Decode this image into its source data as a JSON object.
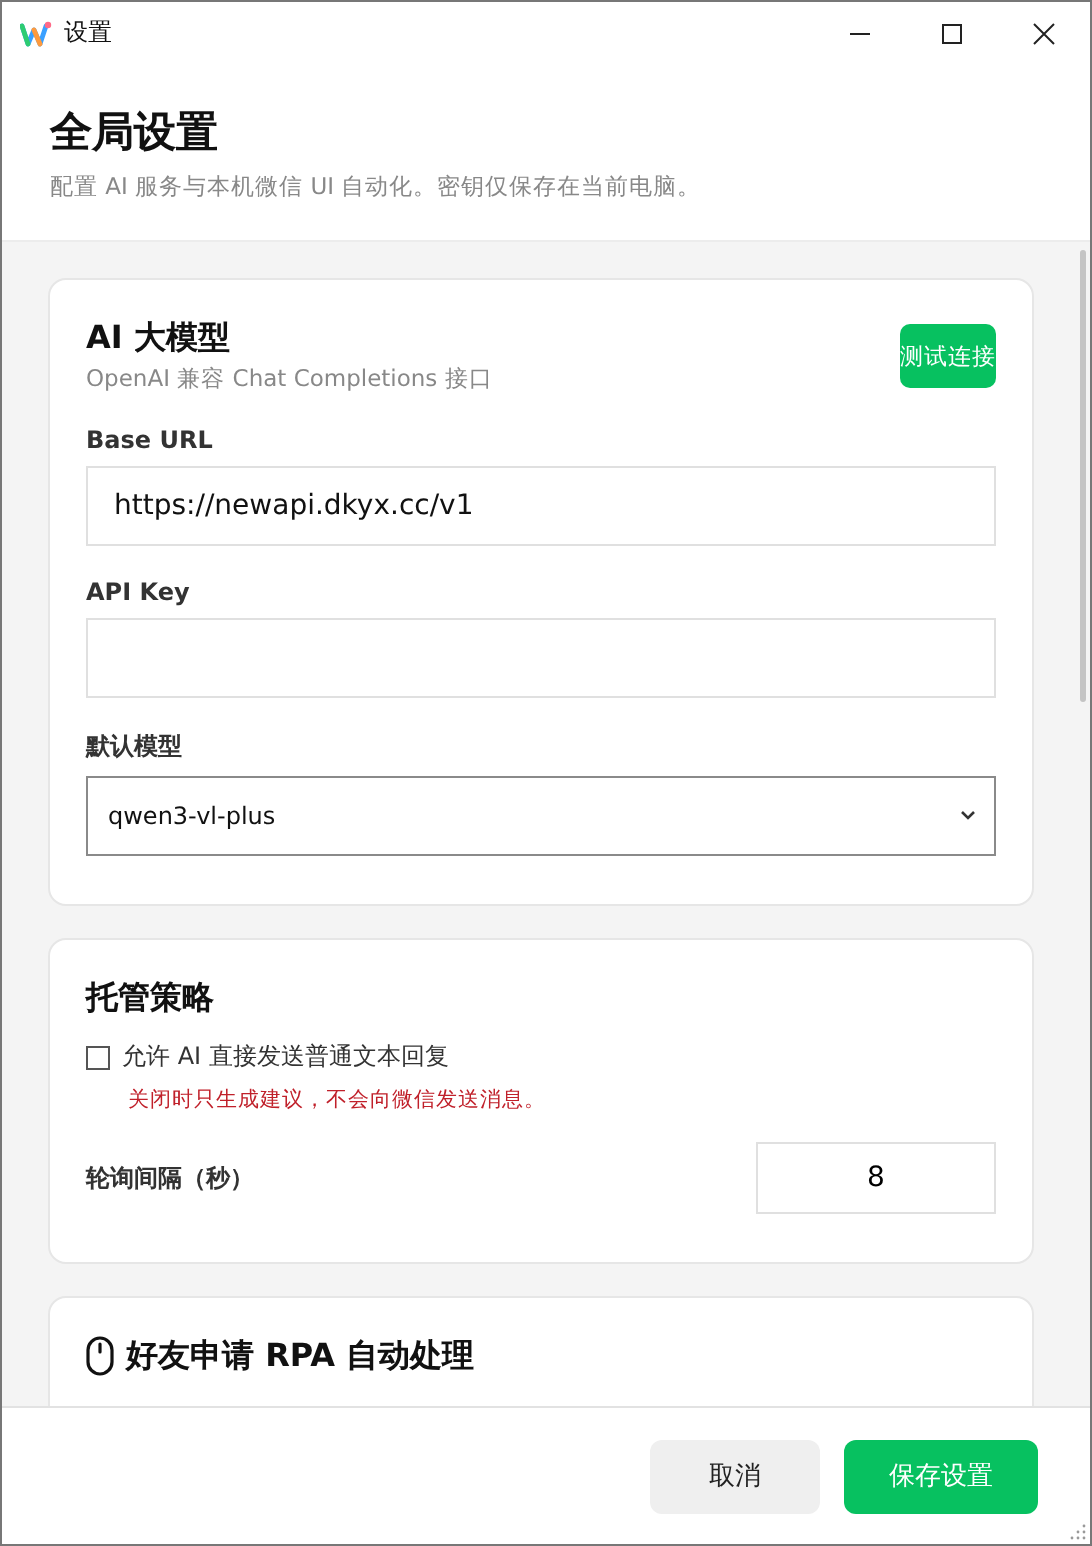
{
  "window": {
    "title": "设置"
  },
  "header": {
    "title": "全局设置",
    "subtitle": "配置 AI 服务与本机微信 UI 自动化。密钥仅保存在当前电脑。"
  },
  "sections": [
    {
      "title": "AI 大模型",
      "subtitle": "OpenAI 兼容 Chat Completions 接口",
      "action": "测试连接",
      "fields": [
        {
          "kind": "text",
          "label": "Base URL",
          "value": "https://newapi.dkyx.cc/v1"
        },
        {
          "kind": "text",
          "label": "API Key"
        },
        {
          "kind": "select",
          "label": "默认模型",
          "value": "qwen3-vl-plus"
        }
      ]
    },
    {
      "title": "托管策略",
      "fields": [
        {
          "kind": "checkbox",
          "label": "允许 AI 直接发送普通文本回复",
          "checked": false,
          "note": "关闭时只生成建议，不会向微信发送消息。"
        },
        {
          "kind": "number",
          "label": "轮询间隔（秒）",
          "value": "8"
        }
      ]
    },
    {
      "title": "好友申请 RPA 自动处理"
    }
  ],
  "footer": {
    "buttons": [
      {
        "label": "取消",
        "kind": "secondary"
      },
      {
        "label": "保存设置",
        "kind": "primary"
      }
    ]
  }
}
